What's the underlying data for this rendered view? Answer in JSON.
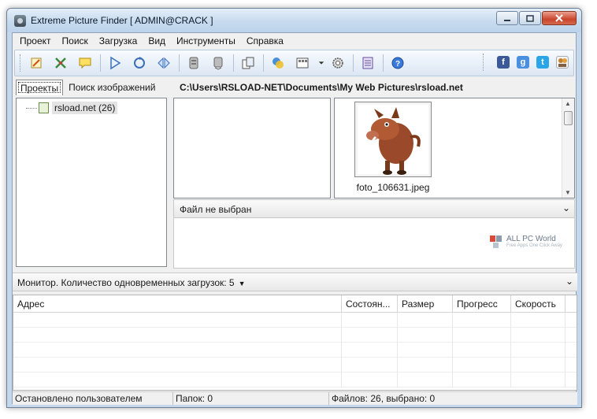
{
  "window": {
    "title": "Extreme Picture Finder [ ADMIN@CRACK ]"
  },
  "menu": [
    "Проект",
    "Поиск",
    "Загрузка",
    "Вид",
    "Инструменты",
    "Справка"
  ],
  "toolbar": {
    "icons": [
      "edit-icon",
      "tools-icon",
      "comment-icon",
      "play-icon",
      "refresh-icon",
      "step-icon",
      "stop-icon",
      "skip-icon",
      "copy-icon",
      "color-icon",
      "view-icon",
      "settings-icon",
      "list-icon",
      "help-icon"
    ],
    "social": [
      "facebook-icon",
      "google-plus-icon",
      "twitter-icon",
      "users-icon"
    ]
  },
  "left_tabs": {
    "projects": "Проекты",
    "image_search": "Поиск изображений"
  },
  "tree": {
    "node_label": "rsload.net (26)"
  },
  "path": "C:\\Users\\RSLOAD-NET\\Documents\\My Web Pictures\\rsload.net",
  "thumbnail": {
    "filename": "foto_106631.jpeg"
  },
  "info": {
    "header": "Файл не выбран"
  },
  "watermark": {
    "title": "ALL PC World",
    "subtitle": "Free Apps One Click Away"
  },
  "monitor": {
    "label": "Монитор. Количество одновременных загрузок: 5"
  },
  "grid": {
    "columns": [
      "Адрес",
      "Состоян...",
      "Размер",
      "Прогресс",
      "Скорость"
    ],
    "empty_rows": 5
  },
  "status": {
    "left": "Остановлено пользователем",
    "middle": "Папок: 0",
    "right": "Файлов: 26, выбрано: 0"
  }
}
